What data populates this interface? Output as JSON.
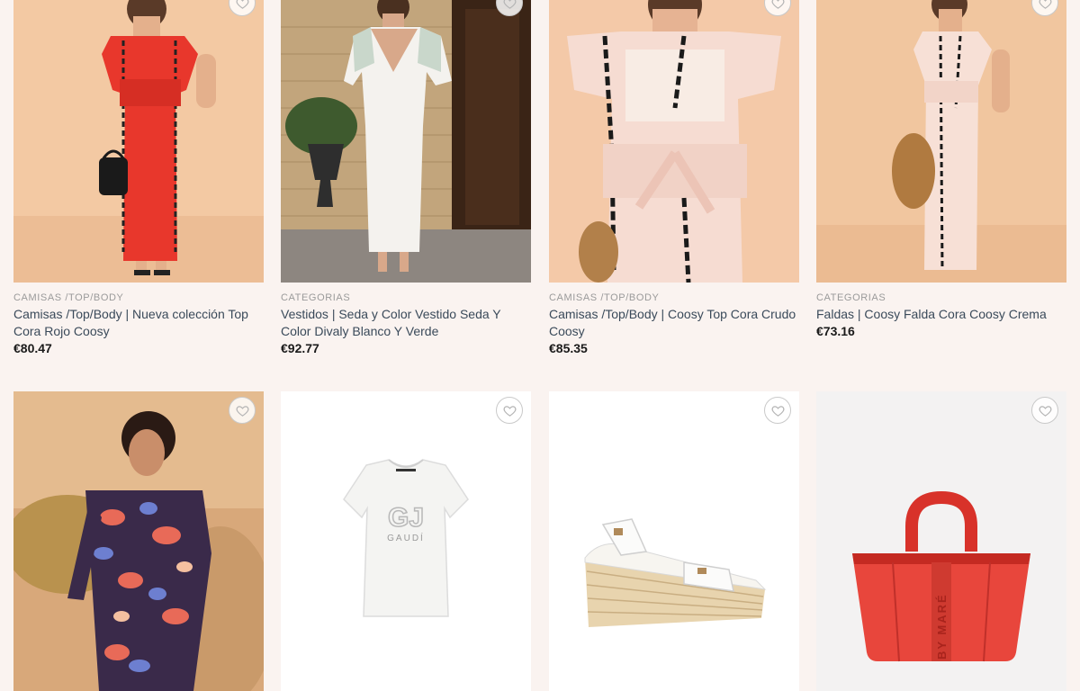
{
  "products": [
    {
      "category": "CAMISAS /TOP/BODY",
      "title": "Camisas /Top/Body | Nueva colección Top Cora Rojo Coosy",
      "price": "€80.47"
    },
    {
      "category": "CATEGORIAS",
      "title": "Vestidos | Seda y Color Vestido Seda Y Color Divaly Blanco Y Verde",
      "price": "€92.77"
    },
    {
      "category": "CAMISAS /TOP/BODY",
      "title": "Camisas /Top/Body | Coosy Top Cora Crudo Coosy",
      "price": "€85.35"
    },
    {
      "category": "CATEGORIAS",
      "title": "Faldas | Coosy Falda Cora Coosy Crema",
      "price": "€73.16"
    }
  ],
  "image_texts": {
    "tshirt_logo": "GJ",
    "tshirt_brand": "GAUDÍ",
    "bag_print": "BY MARÉ"
  },
  "icons": {
    "wishlist": "heart-outline-icon"
  },
  "colors": {
    "page_bg": "#faf3f0",
    "category": "#9a9a9a",
    "title": "#3a4a5a",
    "price": "#1a1a1a"
  }
}
